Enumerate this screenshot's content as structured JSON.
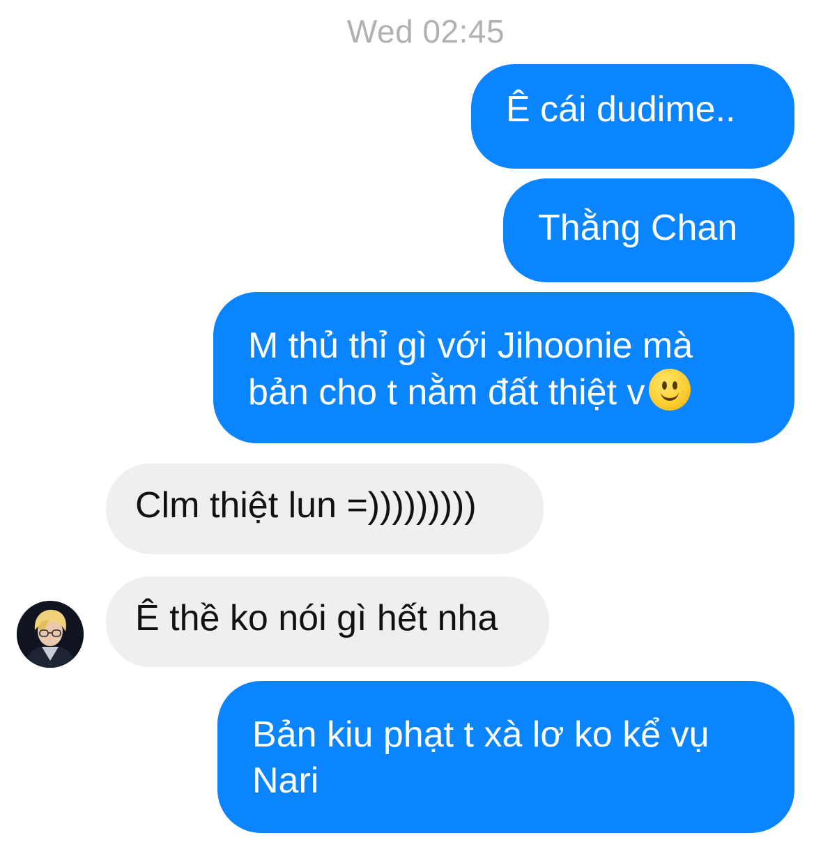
{
  "timestamp": "Wed 02:45",
  "messages": [
    {
      "direction": "outgoing",
      "lines": [
        "Ê cái dudime.."
      ]
    },
    {
      "direction": "outgoing",
      "lines": [
        "Thằng Chan"
      ]
    },
    {
      "direction": "outgoing",
      "lines": [
        "M thủ thỉ gì với Jihoonie mà",
        "bản cho t nằm đất thiệt v"
      ],
      "emoji": "slightly-smiling-face"
    },
    {
      "direction": "incoming",
      "lines": [
        "Clm thiệt lun =)))))))))"
      ]
    },
    {
      "direction": "incoming",
      "lines": [
        "Ê thề ko nói gì hết nha"
      ],
      "avatar": "sender-avatar"
    },
    {
      "direction": "outgoing",
      "lines": [
        "Bản kiu phạt t xà lơ ko kể vụ",
        "Nari"
      ]
    }
  ],
  "colors": {
    "outgoing_bubble": "#0a84ff",
    "incoming_bubble": "#efeff1",
    "timestamp_text": "#b1b1b3"
  }
}
